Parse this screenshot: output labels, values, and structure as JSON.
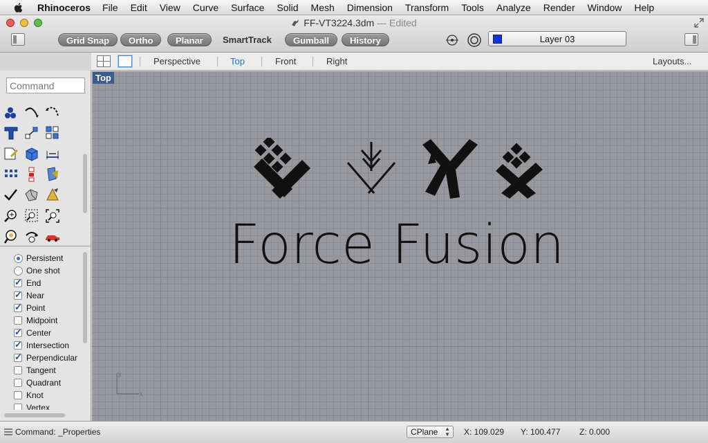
{
  "menubar": {
    "app_name": "Rhinoceros",
    "items": [
      "File",
      "Edit",
      "View",
      "Curve",
      "Surface",
      "Solid",
      "Mesh",
      "Dimension",
      "Transform",
      "Tools",
      "Analyze",
      "Render",
      "Window",
      "Help"
    ]
  },
  "window": {
    "title": "FF-VT3224.3dm",
    "status": "— Edited"
  },
  "toolbar": {
    "grid_snap": "Grid Snap",
    "ortho": "Ortho",
    "planar": "Planar",
    "smarttrack": "SmartTrack",
    "gumball": "Gumball",
    "history": "History",
    "layer": "Layer 03",
    "layer_color": "#1433d6"
  },
  "viewport_tabs": {
    "perspective": "Perspective",
    "top": "Top",
    "front": "Front",
    "right": "Right",
    "layouts": "Layouts..."
  },
  "sidebar": {
    "command_placeholder": "Command",
    "tool_icons": [
      "point-icon",
      "curve-icon",
      "arc-icon",
      "text-icon",
      "transform-icon",
      "array-icon",
      "surface-edit-icon",
      "box-icon",
      "dimension-icon",
      "grid-array-icon",
      "align-icon",
      "material-icon",
      "check-icon",
      "solid-icon",
      "light-icon",
      "zoom-icon",
      "zoom-window-icon",
      "zoom-extents-icon",
      "render-icon",
      "rotate-view-icon",
      "car-icon"
    ],
    "osnap": {
      "mode_persistent": "Persistent",
      "mode_oneshot": "One shot",
      "items": [
        {
          "label": "End",
          "checked": true
        },
        {
          "label": "Near",
          "checked": true
        },
        {
          "label": "Point",
          "checked": true
        },
        {
          "label": "Midpoint",
          "checked": false
        },
        {
          "label": "Center",
          "checked": true
        },
        {
          "label": "Intersection",
          "checked": true
        },
        {
          "label": "Perpendicular",
          "checked": true
        },
        {
          "label": "Tangent",
          "checked": false
        },
        {
          "label": "Quadrant",
          "checked": false
        },
        {
          "label": "Knot",
          "checked": false
        },
        {
          "label": "Vertex",
          "checked": false
        }
      ]
    }
  },
  "viewport": {
    "label": "Top",
    "brand_text": "Force Fusion",
    "axis_x": "x",
    "axis_y": "y"
  },
  "statusbar": {
    "command": "Command: _Properties",
    "cplane": "CPlane",
    "x": "X: 109.029",
    "y": "Y: 100.477",
    "z": "Z: 0.000"
  }
}
